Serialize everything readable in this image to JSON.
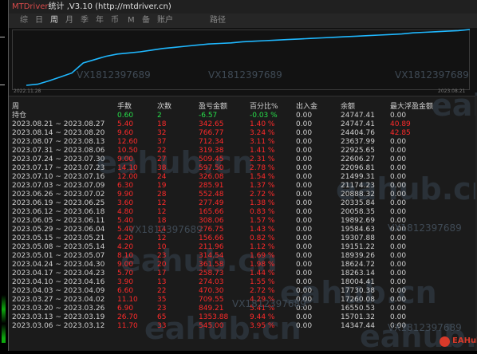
{
  "window": {
    "title_prefix": "MTDriver",
    "title_rest": "统计 ,V3.10 (http://mtdriver.cn)"
  },
  "menu": {
    "items": [
      "综",
      "日",
      "周",
      "月",
      "季",
      "年",
      "币",
      "M",
      "备",
      "账户",
      "路径"
    ],
    "active": "周"
  },
  "chart": {
    "start_date": "2022.11.28",
    "end_date": "2023.08.21",
    "watermarks": [
      "VX1812397689",
      "VX1812397689",
      "VX1812397689"
    ],
    "line_color": "#1fb8ff",
    "equity_curve": [
      0,
      2,
      8,
      15,
      22,
      40,
      46,
      52,
      56,
      58,
      60,
      63,
      66,
      68,
      70,
      72,
      74,
      75,
      76,
      78,
      79,
      80,
      81,
      82,
      83,
      84,
      85,
      86,
      87,
      88,
      89,
      90,
      91,
      92,
      94,
      95,
      96,
      97,
      98,
      100
    ]
  },
  "table": {
    "headers": [
      "周",
      "手数",
      "次数",
      "盈亏金额",
      "百分比%",
      "出入金",
      "余额",
      "最大浮盈金额"
    ],
    "rows": [
      [
        "持仓",
        "0.60",
        "2",
        "-6.57",
        "-0.03 %",
        "0.00",
        "24747.41",
        "0.00"
      ],
      [
        "2023.08.21 ~ 2023.08.27",
        "5.40",
        "18",
        "342.65",
        "1.40 %",
        "0.00",
        "24747.41",
        "40.89"
      ],
      [
        "2023.08.14 ~ 2023.08.20",
        "9.60",
        "32",
        "766.77",
        "3.24 %",
        "0.00",
        "24404.76",
        "42.85"
      ],
      [
        "2023.08.07 ~ 2023.08.13",
        "12.60",
        "37",
        "712.34",
        "3.11 %",
        "0.00",
        "23637.99",
        "0.00"
      ],
      [
        "2023.07.31 ~ 2023.08.06",
        "10.50",
        "22",
        "319.38",
        "1.41 %",
        "0.00",
        "22925.65",
        "0.00"
      ],
      [
        "2023.07.24 ~ 2023.07.30",
        "9.00",
        "27",
        "509.45",
        "2.31 %",
        "0.00",
        "22606.27",
        "0.00"
      ],
      [
        "2023.07.17 ~ 2023.07.23",
        "14.10",
        "38",
        "597.50",
        "2.78 %",
        "0.00",
        "22096.81",
        "0.00"
      ],
      [
        "2023.07.10 ~ 2023.07.16",
        "12.00",
        "24",
        "326.08",
        "1.54 %",
        "0.00",
        "21499.31",
        "0.00"
      ],
      [
        "2023.07.03 ~ 2023.07.09",
        "6.30",
        "19",
        "285.91",
        "1.37 %",
        "0.00",
        "21174.23",
        "0.00"
      ],
      [
        "2023.06.26 ~ 2023.07.02",
        "9.90",
        "28",
        "552.48",
        "2.72 %",
        "0.00",
        "20888.32",
        "0.00"
      ],
      [
        "2023.06.19 ~ 2023.06.25",
        "3.60",
        "12",
        "277.49",
        "1.38 %",
        "0.00",
        "20335.84",
        "0.00"
      ],
      [
        "2023.06.12 ~ 2023.06.18",
        "4.80",
        "12",
        "165.66",
        "0.83 %",
        "0.00",
        "20058.35",
        "0.00"
      ],
      [
        "2023.06.05 ~ 2023.06.11",
        "5.40",
        "18",
        "308.06",
        "1.57 %",
        "0.00",
        "19892.69",
        "0.00"
      ],
      [
        "2023.05.29 ~ 2023.06.04",
        "5.40",
        "14",
        "276.75",
        "1.43 %",
        "0.00",
        "19584.63",
        "0.00"
      ],
      [
        "2023.05.15 ~ 2023.05.21",
        "4.20",
        "12",
        "156.66",
        "0.82 %",
        "0.00",
        "19307.88",
        "0.00"
      ],
      [
        "2023.05.08 ~ 2023.05.14",
        "4.20",
        "10",
        "211.96",
        "1.12 %",
        "0.00",
        "19151.22",
        "0.00"
      ],
      [
        "2023.05.01 ~ 2023.05.07",
        "8.10",
        "23",
        "314.54",
        "1.69 %",
        "0.00",
        "18939.26",
        "0.00"
      ],
      [
        "2023.04.24 ~ 2023.04.30",
        "9.00",
        "20",
        "361.58",
        "1.98 %",
        "0.00",
        "18624.72",
        "0.00"
      ],
      [
        "2023.04.17 ~ 2023.04.23",
        "5.70",
        "17",
        "258.73",
        "1.44 %",
        "0.00",
        "18263.14",
        "0.00"
      ],
      [
        "2023.04.10 ~ 2023.04.16",
        "3.90",
        "13",
        "274.03",
        "1.55 %",
        "0.00",
        "18004.41",
        "0.00"
      ],
      [
        "2023.04.03 ~ 2023.04.09",
        "6.60",
        "22",
        "470.30",
        "2.72 %",
        "0.00",
        "17730.38",
        "0.00"
      ],
      [
        "2023.03.27 ~ 2023.04.02",
        "11.10",
        "35",
        "709.55",
        "4.29 %",
        "0.00",
        "17260.08",
        "0.00"
      ],
      [
        "2023.03.20 ~ 2023.03.26",
        "6.90",
        "23",
        "849.21",
        "5.41 %",
        "0.00",
        "16550.53",
        "0.00"
      ],
      [
        "2023.03.13 ~ 2023.03.19",
        "26.70",
        "65",
        "1353.88",
        "9.44 %",
        "0.00",
        "15701.32",
        "0.00"
      ],
      [
        "2023.03.06 ~ 2023.03.12",
        "11.70",
        "33",
        "545.00",
        "3.95 %",
        "0.00",
        "14347.44",
        "0.00"
      ]
    ],
    "watermarks": [
      "VX1812397689",
      "VX1812397689",
      "VX1812397689",
      "VX1812397689"
    ]
  },
  "big_watermarks": [
    "eahub.cn",
    "eahub.cn",
    "eahub.cn",
    "eahub.cn",
    "eahub.cn",
    "eahub.cn",
    "eahub.cn"
  ],
  "logo": {
    "text": "EAHub"
  },
  "colors": {
    "positive": "#ff2a2a",
    "green": "#27e04a",
    "curve": "#1fb8ff"
  }
}
